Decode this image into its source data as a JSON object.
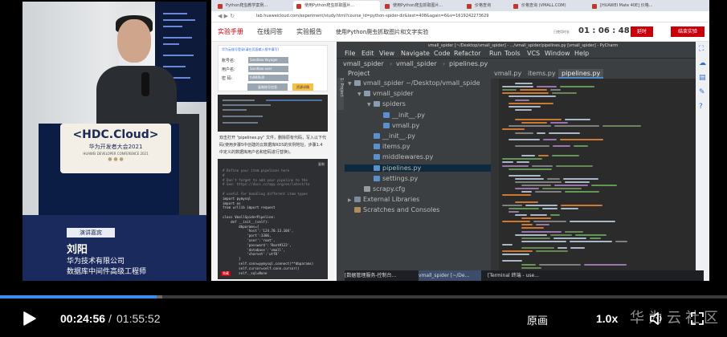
{
  "event": {
    "logo": "<HDC.Cloud>",
    "subtitle": "华为开发者大会2021",
    "subtitle_en": "HUAWEI DEVELOPER CONFERENCE 2021"
  },
  "speaker": {
    "tag": "演讲嘉宾",
    "name": "刘阳",
    "company": "华为技术有限公司",
    "title": "数据库中间件高级工程师"
  },
  "browser": {
    "tabs": [
      {
        "label": "Python爬虫教学案例..."
      },
      {
        "label": "使用Python爬虫抓取图片..."
      },
      {
        "label": "使用Python爬虫抓取图片..."
      },
      {
        "label": "价格查询"
      },
      {
        "label": "价格查询 (VMALL.COM)"
      },
      {
        "label": "[HUAWEI Mate 40E] 价格..."
      }
    ],
    "url": "lab.huaweicloud.com/experiment/study.html?course_id=python-spider-dir&test=408&again=6&v=1619242273629",
    "lab_tabs": [
      "实验手册",
      "在线问答",
      "实验报告"
    ],
    "lab_title": "使用Python爬虫抓取图片和文字实验",
    "elapsed_label": "已使用时长",
    "timer": "01 : 06 : 48",
    "extend_label": "延时",
    "end_label": "结束实验"
  },
  "panel": {
    "info_header": "华为云账号登录(请在页面输入框中填写)",
    "rows": [
      {
        "label": "账号名:",
        "value": "Sandbox-Voyager"
      },
      {
        "label": "用户名:",
        "value": "Sandbox-user"
      },
      {
        "label": "密  码:",
        "value": "fuN4Rk0l"
      }
    ],
    "copy_btn": "复制账号信息",
    "resource_btn": "资源详情",
    "step_text": "双击打开 \"pipelines.py\" 文件，删除原有代码，写入以下代码(使用步骤5中创建的云数据库RDS的实例地址，步骤1.4中定义的数据库用户名和密码进行替换)。",
    "copy_code": "复制",
    "hide": "隐藏",
    "code": [
      "# Define your item pipelines here",
      "#",
      "# Don't forget to add your pipeline to the",
      "# See: https://docs.scrapy.org/en/latest/to",
      "",
      "# useful for handling different item types",
      "import pymysql",
      "import os",
      "from urllib import request",
      "",
      "class VmallSpiderPipeline:",
      "    def __init__(self):",
      "        dbparams={",
      "            'host':'124.70.13.104',",
      "            'port':3306,",
      "            'user':'root',",
      "            'password':'Root#123',",
      "            'database':'vmall',",
      "            'charset':'utf8'",
      "        }",
      "        self.conn=pymysql.connect(**dbparams)",
      "        self.cursor=self.conn.cursor()",
      "        self._sql=None"
    ]
  },
  "ide": {
    "window_title": "vmall_spider [~/Desktop/vmall_spider] - .../vmall_spider/pipelines.py [vmall_spider] - PyCharm",
    "menu": [
      "File",
      "Edit",
      "View",
      "Navigate",
      "Code",
      "Refactor",
      "Run",
      "Tools",
      "VCS",
      "Window",
      "Help"
    ],
    "breadcrumbs": [
      "vmall_spider",
      "vmall_spider",
      "pipelines.py"
    ],
    "project_label": "Project",
    "tool_tab": "1: Project",
    "tree": [
      {
        "label": "vmall_spider ~/Desktop/vmall_spide",
        "depth": 0,
        "kind": "folder",
        "arrow": "down"
      },
      {
        "label": "vmall_spider",
        "depth": 1,
        "kind": "folder",
        "arrow": "down"
      },
      {
        "label": "spiders",
        "depth": 2,
        "kind": "folder",
        "arrow": "down"
      },
      {
        "label": "__init__.py",
        "depth": 3,
        "kind": "py"
      },
      {
        "label": "vmall.py",
        "depth": 3,
        "kind": "py"
      },
      {
        "label": "__init__.py",
        "depth": 2,
        "kind": "py"
      },
      {
        "label": "items.py",
        "depth": 2,
        "kind": "py"
      },
      {
        "label": "middlewares.py",
        "depth": 2,
        "kind": "py"
      },
      {
        "label": "pipelines.py",
        "depth": 2,
        "kind": "py",
        "selected": true
      },
      {
        "label": "settings.py",
        "depth": 2,
        "kind": "py"
      },
      {
        "label": "scrapy.cfg",
        "depth": 1,
        "kind": "cfg"
      },
      {
        "label": "External Libraries",
        "depth": 0,
        "kind": "lib",
        "arrow": "right"
      },
      {
        "label": "Scratches and Consoles",
        "depth": 0,
        "kind": "scratch"
      }
    ],
    "editor_tabs": [
      "vmall.py",
      "items.py",
      "pipelines.py"
    ]
  },
  "taskbar": [
    {
      "label": "[数据管理服务-控制台..."
    },
    {
      "label": "vmall_spider [~/De..."
    },
    {
      "label": "[Terminal 终端 - use..."
    }
  ],
  "player": {
    "current": "00:24:56",
    "separator": "/",
    "total": "01:55:52",
    "progress": 0.2152,
    "buffered": 0.2237,
    "quality": "原画",
    "speed": "1.0x",
    "watermark": "华为云社区"
  },
  "colors": {
    "accent": "#c7000b",
    "progress": "#3d8cf0",
    "ide_bg": "#2b2b2b",
    "namecard": "#1a2a5c"
  }
}
